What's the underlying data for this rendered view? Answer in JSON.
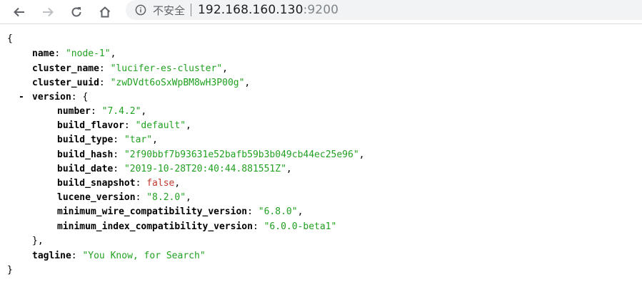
{
  "browser": {
    "security_label": "不安全",
    "url_host": "192.168.160.130",
    "url_port": ":9200"
  },
  "json": {
    "open_brace": "{",
    "close_brace": "}",
    "collapse_toggle": "-",
    "name": {
      "key": "name",
      "value": "\"node-1\""
    },
    "cluster_name": {
      "key": "cluster_name",
      "value": "\"lucifer-es-cluster\""
    },
    "cluster_uuid": {
      "key": "cluster_uuid",
      "value": "\"zwDVdt6oSxWpBM8wH3P00g\""
    },
    "version_key": "version",
    "version_open": "{",
    "version_close": "},",
    "version": [
      {
        "key": "number",
        "value": "\"7.4.2\"",
        "type": "string"
      },
      {
        "key": "build_flavor",
        "value": "\"default\"",
        "type": "string"
      },
      {
        "key": "build_type",
        "value": "\"tar\"",
        "type": "string"
      },
      {
        "key": "build_hash",
        "value": "\"2f90bbf7b93631e52bafb59b3b049cb44ec25e96\"",
        "type": "string"
      },
      {
        "key": "build_date",
        "value": "\"2019-10-28T20:40:44.881551Z\"",
        "type": "string"
      },
      {
        "key": "build_snapshot",
        "value": "false",
        "type": "boolean"
      },
      {
        "key": "lucene_version",
        "value": "\"8.2.0\"",
        "type": "string"
      },
      {
        "key": "minimum_wire_compatibility_version",
        "value": "\"6.8.0\"",
        "type": "string"
      },
      {
        "key": "minimum_index_compatibility_version",
        "value": "\"6.0.0-beta1\"",
        "type": "string"
      }
    ],
    "tagline": {
      "key": "tagline",
      "value": "\"You Know, for Search\""
    }
  },
  "colors": {
    "string": "#21a121",
    "boolean": "#c0392b",
    "key": "#000000"
  },
  "icons": [
    "back-arrow-icon",
    "forward-arrow-icon",
    "reload-icon",
    "home-icon",
    "info-icon"
  ]
}
